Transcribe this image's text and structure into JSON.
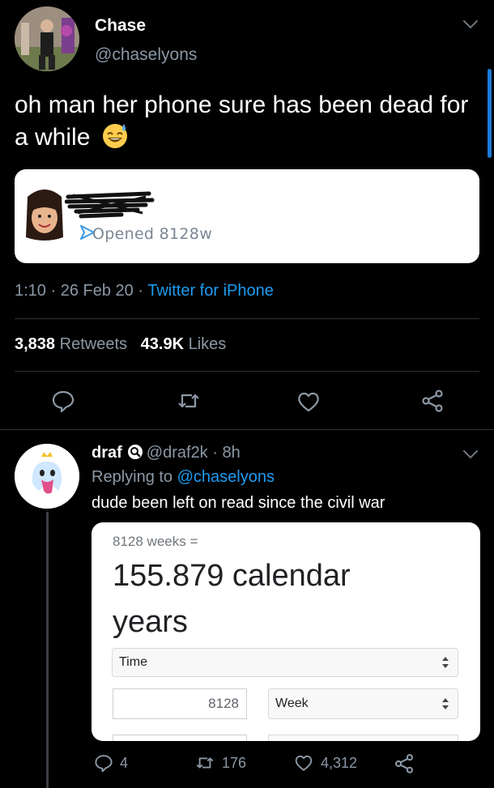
{
  "tweet": {
    "name": "Chase",
    "handle": "@chaselyons",
    "text": "oh man her phone sure has been dead for a while",
    "emoji": "sweat-smile-emoji",
    "snap": {
      "status": "Opened 8128w"
    },
    "time": "1:10",
    "date": "26 Feb 20",
    "separator": " · ",
    "source": "Twitter for iPhone",
    "retweets_count": "3,838",
    "retweets_label": "Retweets",
    "likes_count": "43.9K",
    "likes_label": "Likes"
  },
  "reply": {
    "name": "draf",
    "handle": "@draf2k",
    "age": "· 8h",
    "replying_prefix": "Replying to",
    "replying_to": "@chaselyons",
    "text": "dude been left on read since the civil war",
    "calc": {
      "subtitle": "8128 weeks =",
      "result_line1": "155.879 calendar",
      "result_line2": "years",
      "unit_select": "Time",
      "input_value": "8128",
      "input_unit": "Week"
    },
    "replies": "4",
    "retweets": "176",
    "likes": "4,312"
  },
  "colors": {
    "background": "#000000",
    "accent": "#1d9bf0",
    "muted": "#8b98a5"
  }
}
